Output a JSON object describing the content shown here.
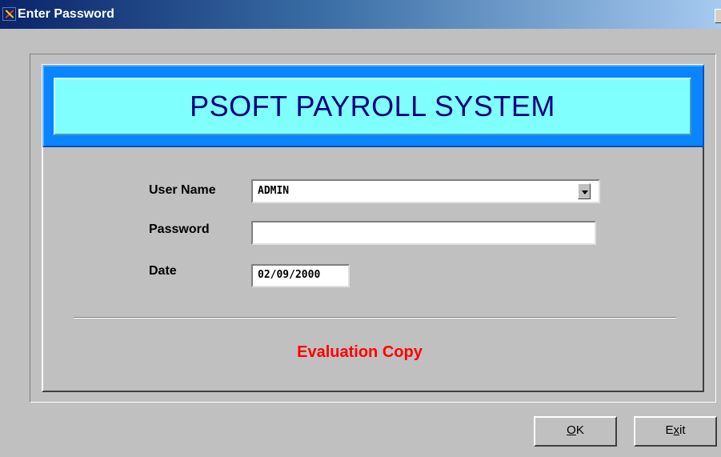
{
  "window": {
    "title": "Enter Password"
  },
  "banner": {
    "title": "PSOFT PAYROLL SYSTEM"
  },
  "form": {
    "user_name_label": "User Name",
    "user_name_value": "ADMIN",
    "password_label": "Password",
    "password_value": "",
    "date_label": "Date",
    "date_value": "02/09/2000"
  },
  "notice": {
    "text": "Evaluation Copy"
  },
  "buttons": {
    "ok_label": "OK",
    "ok_mnemonic": "O",
    "ok_rest": "K",
    "exit_label": "Exit",
    "exit_pre": "E",
    "exit_mnemonic": "x",
    "exit_rest": "it"
  },
  "colors": {
    "banner_bg": "#80ffff",
    "banner_border": "#0a84ff",
    "banner_text": "#000080",
    "notice_text": "#ff0000",
    "window_bg": "#c0c0c0"
  },
  "icons": {
    "app_icon": "psoft-logo-icon",
    "dropdown": "chevron-down-icon"
  }
}
